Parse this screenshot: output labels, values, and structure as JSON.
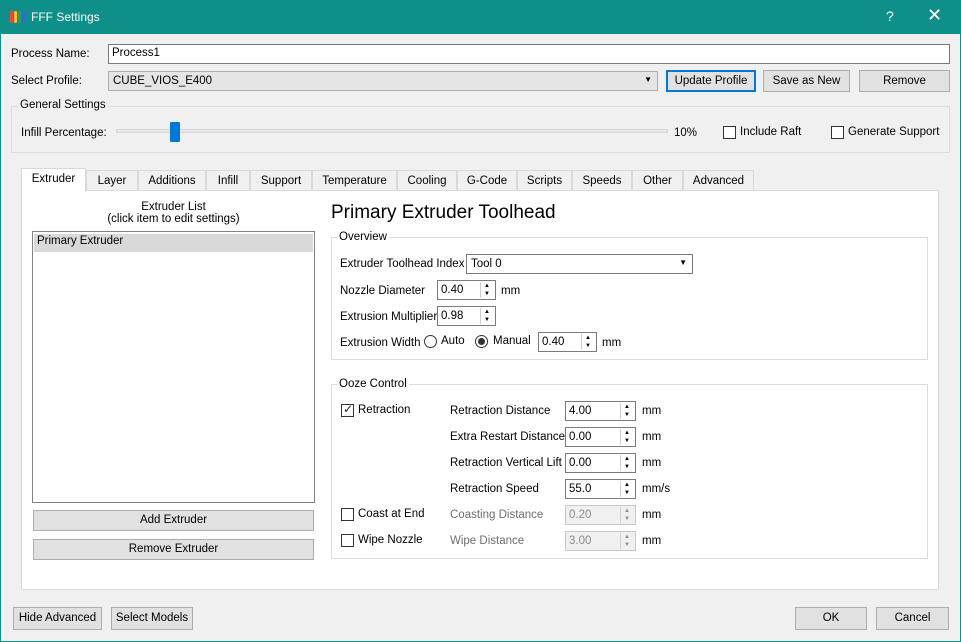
{
  "window": {
    "title": "FFF Settings",
    "help_label": "?",
    "close_label": "✕",
    "icon_colors": [
      "#e94b3c",
      "#f2c230",
      "#2f9e5b",
      "#2d6fd6"
    ]
  },
  "process": {
    "name_label": "Process Name:",
    "name_value": "Process1"
  },
  "profile": {
    "label": "Select Profile:",
    "selected": "CUBE_VIOS_E400",
    "update_label": "Update Profile",
    "save_new_label": "Save as New",
    "remove_label": "Remove"
  },
  "general": {
    "title": "General Settings",
    "infill_label": "Infill Percentage:",
    "infill_value": "10%",
    "infill_fraction": 0.1,
    "include_raft_label": "Include Raft",
    "include_raft_checked": false,
    "generate_support_label": "Generate Support",
    "generate_support_checked": false
  },
  "tabs": [
    "Extruder",
    "Layer",
    "Additions",
    "Infill",
    "Support",
    "Temperature",
    "Cooling",
    "G-Code",
    "Scripts",
    "Speeds",
    "Other",
    "Advanced"
  ],
  "active_tab": "Extruder",
  "extruder_list": {
    "title_line1": "Extruder List",
    "title_line2": "(click item to edit settings)",
    "items": [
      "Primary Extruder"
    ],
    "add_label": "Add Extruder",
    "remove_label": "Remove Extruder"
  },
  "toolhead": {
    "heading": "Primary Extruder Toolhead",
    "overview_title": "Overview",
    "index_label": "Extruder Toolhead Index",
    "index_value": "Tool 0",
    "nozzle_label": "Nozzle Diameter",
    "nozzle_value": "0.40",
    "nozzle_unit": "mm",
    "multiplier_label": "Extrusion Multiplier",
    "multiplier_value": "0.98",
    "width_label": "Extrusion Width",
    "width_auto_label": "Auto",
    "width_manual_label": "Manual",
    "width_mode": "Manual",
    "width_value": "0.40",
    "width_unit": "mm"
  },
  "ooze": {
    "title": "Ooze Control",
    "retraction_label": "Retraction",
    "retraction_checked": true,
    "coast_label": "Coast at End",
    "coast_checked": false,
    "wipe_label": "Wipe Nozzle",
    "wipe_checked": false,
    "rows": [
      {
        "label": "Retraction Distance",
        "value": "4.00",
        "unit": "mm",
        "enabled": true
      },
      {
        "label": "Extra Restart Distance",
        "value": "0.00",
        "unit": "mm",
        "enabled": true
      },
      {
        "label": "Retraction Vertical Lift",
        "value": "0.00",
        "unit": "mm",
        "enabled": true
      },
      {
        "label": "Retraction Speed",
        "value": "55.0",
        "unit": "mm/s",
        "enabled": true
      },
      {
        "label": "Coasting Distance",
        "value": "0.20",
        "unit": "mm",
        "enabled": false
      },
      {
        "label": "Wipe Distance",
        "value": "3.00",
        "unit": "mm",
        "enabled": false
      }
    ]
  },
  "footer": {
    "hide_advanced_label": "Hide Advanced",
    "select_models_label": "Select Models",
    "ok_label": "OK",
    "cancel_label": "Cancel"
  }
}
